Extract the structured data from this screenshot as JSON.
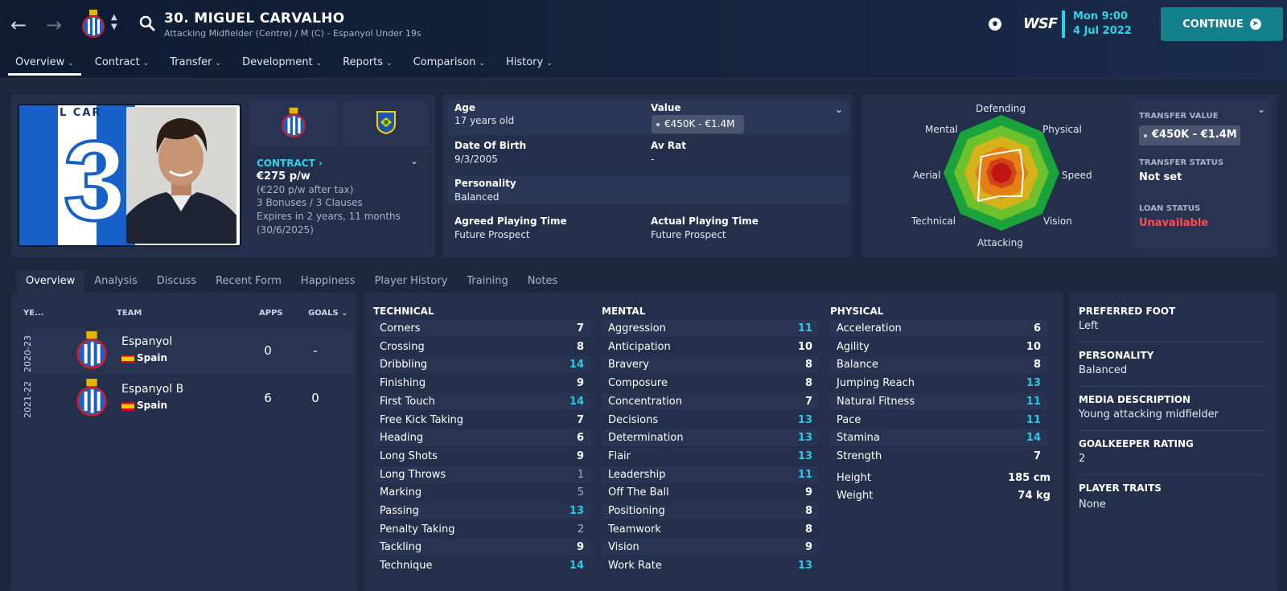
{
  "header": {
    "title": "30. MIGUEL CARVALHO",
    "subtitle": "Attacking Midfielder (Centre) / M (C) - Espanyol Under 19s",
    "date_day": "Mon 9:00",
    "date_date": "4 Jul 2022",
    "continue_label": "CONTINUE",
    "brand": "WSF"
  },
  "nav_tabs": [
    {
      "label": "Overview",
      "active": true
    },
    {
      "label": "Contract"
    },
    {
      "label": "Transfer"
    },
    {
      "label": "Development"
    },
    {
      "label": "Reports"
    },
    {
      "label": "Comparison"
    },
    {
      "label": "History"
    }
  ],
  "photo": {
    "shirt_name": "L CAR",
    "shirt_number": "3"
  },
  "contract": {
    "label": "CONTRACT",
    "wage": "€275 p/w",
    "after_tax": "(€220 p/w after tax)",
    "bonuses": "3 Bonuses / 3 Clauses",
    "expires": "Expires in 2 years, 11 months",
    "expiry_date": "(30/6/2025)"
  },
  "info": {
    "age_label": "Age",
    "age_value": "17 years old",
    "value_label": "Value",
    "value_value": "€450K - €1.4M",
    "dob_label": "Date Of Birth",
    "dob_value": "9/3/2005",
    "avrat_label": "Av Rat",
    "avrat_value": "-",
    "personality_label": "Personality",
    "personality_value": "Balanced",
    "agreed_label": "Agreed Playing Time",
    "agreed_value": "Future Prospect",
    "actual_label": "Actual Playing Time",
    "actual_value": "Future Prospect"
  },
  "radar": {
    "labels": {
      "defending": "Defending",
      "physical": "Physical",
      "speed": "Speed",
      "vision": "Vision",
      "attacking": "Attacking",
      "technical": "Technical",
      "aerial": "Aerial",
      "mental": "Mental"
    }
  },
  "transfer": {
    "tv_label": "TRANSFER VALUE",
    "tv_value": "€450K - €1.4M",
    "status_label": "TRANSFER STATUS",
    "status_value": "Not set",
    "loan_label": "LOAN STATUS",
    "loan_value": "Unavailable"
  },
  "sub_tabs": [
    "Overview",
    "Analysis",
    "Discuss",
    "Recent Form",
    "Happiness",
    "Player History",
    "Training",
    "Notes"
  ],
  "history": {
    "headers": {
      "year": "YE...",
      "team": "TEAM",
      "apps": "APPS",
      "goals": "GOALS"
    },
    "rows": [
      {
        "year": "2020-23",
        "team": "Espanyol",
        "nation": "Spain",
        "apps": "0",
        "goals": "-"
      },
      {
        "year": "2021-22",
        "team": "Espanyol B",
        "nation": "Spain",
        "apps": "6",
        "goals": "0"
      }
    ]
  },
  "attributes": {
    "technical_title": "TECHNICAL",
    "mental_title": "MENTAL",
    "physical_title": "PHYSICAL",
    "technical": [
      {
        "name": "Corners",
        "value": "7"
      },
      {
        "name": "Crossing",
        "value": "8"
      },
      {
        "name": "Dribbling",
        "value": "14"
      },
      {
        "name": "Finishing",
        "value": "9"
      },
      {
        "name": "First Touch",
        "value": "14"
      },
      {
        "name": "Free Kick Taking",
        "value": "7"
      },
      {
        "name": "Heading",
        "value": "6"
      },
      {
        "name": "Long Shots",
        "value": "9"
      },
      {
        "name": "Long Throws",
        "value": "1"
      },
      {
        "name": "Marking",
        "value": "5"
      },
      {
        "name": "Passing",
        "value": "13"
      },
      {
        "name": "Penalty Taking",
        "value": "2"
      },
      {
        "name": "Tackling",
        "value": "9"
      },
      {
        "name": "Technique",
        "value": "14"
      }
    ],
    "mental": [
      {
        "name": "Aggression",
        "value": "11"
      },
      {
        "name": "Anticipation",
        "value": "10"
      },
      {
        "name": "Bravery",
        "value": "8"
      },
      {
        "name": "Composure",
        "value": "8"
      },
      {
        "name": "Concentration",
        "value": "7"
      },
      {
        "name": "Decisions",
        "value": "13"
      },
      {
        "name": "Determination",
        "value": "13"
      },
      {
        "name": "Flair",
        "value": "13"
      },
      {
        "name": "Leadership",
        "value": "11"
      },
      {
        "name": "Off The Ball",
        "value": "9"
      },
      {
        "name": "Positioning",
        "value": "8"
      },
      {
        "name": "Teamwork",
        "value": "8"
      },
      {
        "name": "Vision",
        "value": "9"
      },
      {
        "name": "Work Rate",
        "value": "13"
      }
    ],
    "physical": [
      {
        "name": "Acceleration",
        "value": "6"
      },
      {
        "name": "Agility",
        "value": "10"
      },
      {
        "name": "Balance",
        "value": "8"
      },
      {
        "name": "Jumping Reach",
        "value": "13"
      },
      {
        "name": "Natural Fitness",
        "value": "11"
      },
      {
        "name": "Pace",
        "value": "11"
      },
      {
        "name": "Stamina",
        "value": "14"
      },
      {
        "name": "Strength",
        "value": "7"
      }
    ],
    "height_label": "Height",
    "height_value": "185 cm",
    "weight_label": "Weight",
    "weight_value": "74 kg"
  },
  "profile": {
    "foot_label": "PREFERRED FOOT",
    "foot_value": "Left",
    "personality_label": "PERSONALITY",
    "personality_value": "Balanced",
    "media_label": "MEDIA DESCRIPTION",
    "media_value": "Young attacking midfielder",
    "gk_label": "GOALKEEPER RATING",
    "gk_value": "2",
    "traits_label": "PLAYER TRAITS",
    "traits_value": "None"
  },
  "colors": {
    "accent": "#2dd3e8",
    "highlight_value": "#2dc7e8",
    "unavailable": "#ff4d4d",
    "continue": "#13808c"
  }
}
